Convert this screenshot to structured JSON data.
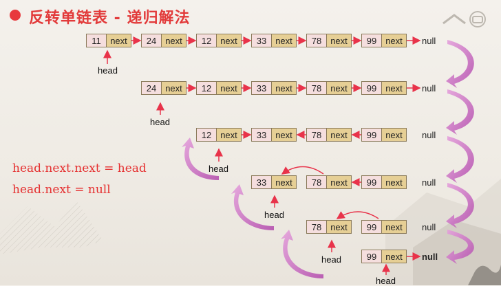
{
  "title": "反转单链表 - 递归解法",
  "next_label": "next",
  "null_label": "null",
  "head_label": "head",
  "formulas": [
    "head.next.next = head",
    "head.next = null"
  ],
  "rows": [
    {
      "values": [
        "11",
        "24",
        "12",
        "33",
        "78",
        "99"
      ]
    },
    {
      "values": [
        "24",
        "12",
        "33",
        "78",
        "99"
      ]
    },
    {
      "values": [
        "12",
        "33",
        "78",
        "99"
      ]
    },
    {
      "values": [
        "33",
        "78",
        "99"
      ]
    },
    {
      "values": [
        "78",
        "99"
      ]
    },
    {
      "values": [
        "99"
      ]
    }
  ],
  "colors": {
    "accent": "#e23a3a",
    "arrow": "#e8334a",
    "swirl": "#c95fbf",
    "value_bg": "#f5dede",
    "next_bg": "#e6cf95"
  }
}
